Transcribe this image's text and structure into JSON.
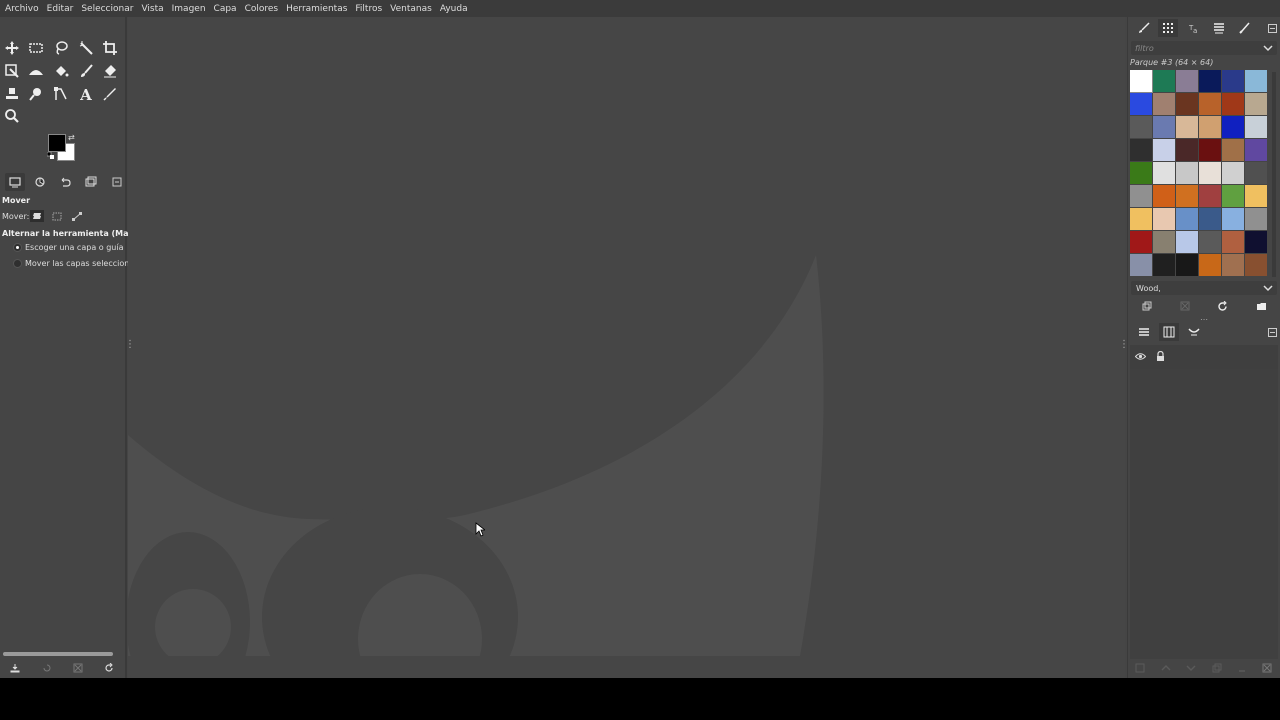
{
  "menubar": {
    "items": [
      "Archivo",
      "Editar",
      "Seleccionar",
      "Vista",
      "Imagen",
      "Capa",
      "Colores",
      "Herramientas",
      "Filtros",
      "Ventanas",
      "Ayuda"
    ]
  },
  "toolbox": {
    "tools": [
      "move-icon",
      "rect-select-icon",
      "lasso-icon",
      "fuzzy-select-icon",
      "crop-icon",
      "transform-icon",
      "warp-icon",
      "bucket-fill-icon",
      "paintbrush-icon",
      "eraser-icon",
      "clone-icon",
      "smudge-icon",
      "paths-icon",
      "text-icon",
      "color-picker-icon",
      "zoom-icon"
    ],
    "fg_color": "#000000",
    "bg_color": "#ffffff"
  },
  "tool_options": {
    "title": "Mover",
    "move_label": "Mover:",
    "toggle_label": "Alternar la herramienta  (Mayús)",
    "option1": "Escoger una capa o guía",
    "option2": "Mover las capas seleccionad",
    "selected_option": 1
  },
  "patterns": {
    "filter_placeholder": "filtro",
    "title": "Parque #3 (64 × 64)",
    "swatches": [
      "#ffffff",
      "#1e7a55",
      "#8a7d95",
      "#0a1a5a",
      "#2a3a8a",
      "#8ab8d8",
      "#2a4ae0",
      "#a08070",
      "#6a3520",
      "#b8622a",
      "#a03818",
      "#b8a890",
      "#5a5a5a",
      "#6a7ab0",
      "#d8b898",
      "#d0a070",
      "#1020c0",
      "#c8d0d8",
      "#2f2f2f",
      "#c8d0e8",
      "#4a2828",
      "#6a1010",
      "#a07048",
      "#6048a0",
      "#3a7a18",
      "#e0e0e0",
      "#c8c8c8",
      "#e8e0d8",
      "#d0d0d0",
      "#505050",
      "#909090",
      "#d06018",
      "#d07020",
      "#a04040",
      "#60a040",
      "#f0c060",
      "#f0c060",
      "#e8c8b0",
      "#6890c8",
      "#3a5a8a",
      "#88b0e0",
      "#909090",
      "#a01818",
      "#888070",
      "#b8c8e8",
      "#5a5a5a",
      "#b06040",
      "#101030",
      "#8890a8",
      "#202020",
      "#181818",
      "#c86818",
      "#a07050",
      "#885030"
    ],
    "preset": "Wood,"
  },
  "right_tabs": [
    "brush-icon",
    "pattern-icon",
    "font-icon",
    "gradient-icon",
    "paintbrush-small-icon"
  ]
}
